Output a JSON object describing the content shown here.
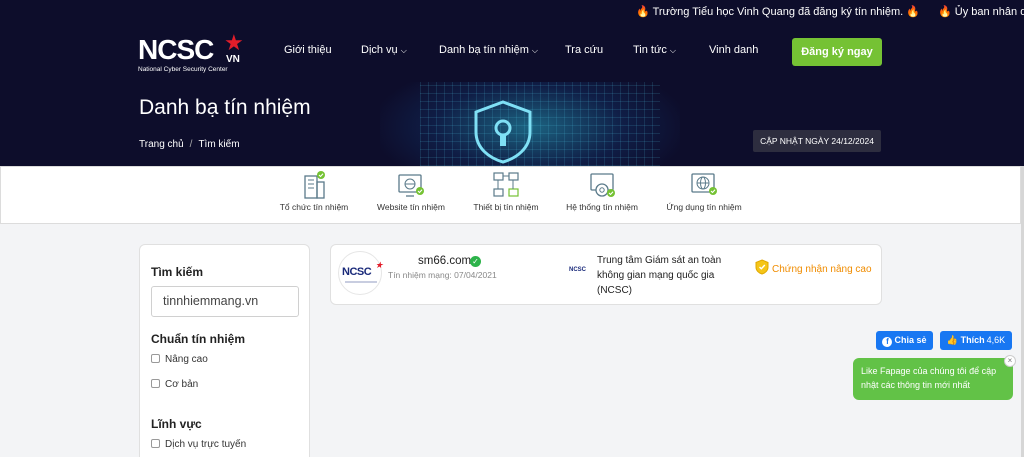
{
  "ticker": {
    "items": [
      "Trường Tiểu học Vinh Quang đã đăng ký tín nhiệm.",
      "Ủy ban nhân dâ"
    ]
  },
  "header": {
    "logo_text": "NCSC",
    "logo_suffix": "VN",
    "logo_sub": "National Cyber Security Center",
    "nav": [
      {
        "label": "Giới thiệu",
        "has_dropdown": false
      },
      {
        "label": "Dịch vụ",
        "has_dropdown": true
      },
      {
        "label": "Danh bạ tín nhiệm",
        "has_dropdown": true
      },
      {
        "label": "Tra cứu",
        "has_dropdown": false
      },
      {
        "label": "Tin tức",
        "has_dropdown": true
      },
      {
        "label": "Vinh danh",
        "has_dropdown": false
      }
    ],
    "cta_label": "Đăng ký ngay"
  },
  "banner": {
    "title": "Danh bạ tín nhiệm",
    "breadcrumb": [
      "Trang chủ",
      "Tìm kiếm"
    ],
    "updated": "CẬP NHẬT NGÀY 24/12/2024"
  },
  "categories": [
    {
      "label": "Tổ chức tín nhiệm",
      "icon": "building-icon"
    },
    {
      "label": "Website tín nhiệm",
      "icon": "website-icon"
    },
    {
      "label": "Thiết bị tín nhiệm",
      "icon": "device-network-icon"
    },
    {
      "label": "Hệ thống tín nhiệm",
      "icon": "system-gear-icon"
    },
    {
      "label": "Ứng dụng tín nhiệm",
      "icon": "app-globe-icon"
    }
  ],
  "sidebar": {
    "search_heading": "Tìm kiếm",
    "search_value": "tinnhiemmang.vn",
    "standard_heading": "Chuẩn tín nhiệm",
    "standard_options": [
      "Nâng cao",
      "Cơ bản"
    ],
    "field_heading": "Lĩnh vực",
    "field_options": [
      "Dịch vụ trực tuyến"
    ]
  },
  "result": {
    "logo_text": "NCSC",
    "domain": "sm66.com",
    "trusted_since": "Tín nhiệm mạng: 07/04/2021",
    "org_logo_text": "NCSC",
    "organization": "Trung tâm Giám sát an toàn không gian mạng quốc gia (NCSC)",
    "certification": "Chứng nhận nâng cao"
  },
  "social": {
    "share_label": "Chia sẻ",
    "like_label": "Thích",
    "like_count": "4,6K",
    "bubble_text": "Like Fapage của chúng tôi để cập nhật các thông tin mới nhất",
    "bubble_close": "×"
  },
  "colors": {
    "navy": "#0d0d2b",
    "green": "#75c234",
    "orange": "#f08c00",
    "facebook": "#1877f2"
  }
}
